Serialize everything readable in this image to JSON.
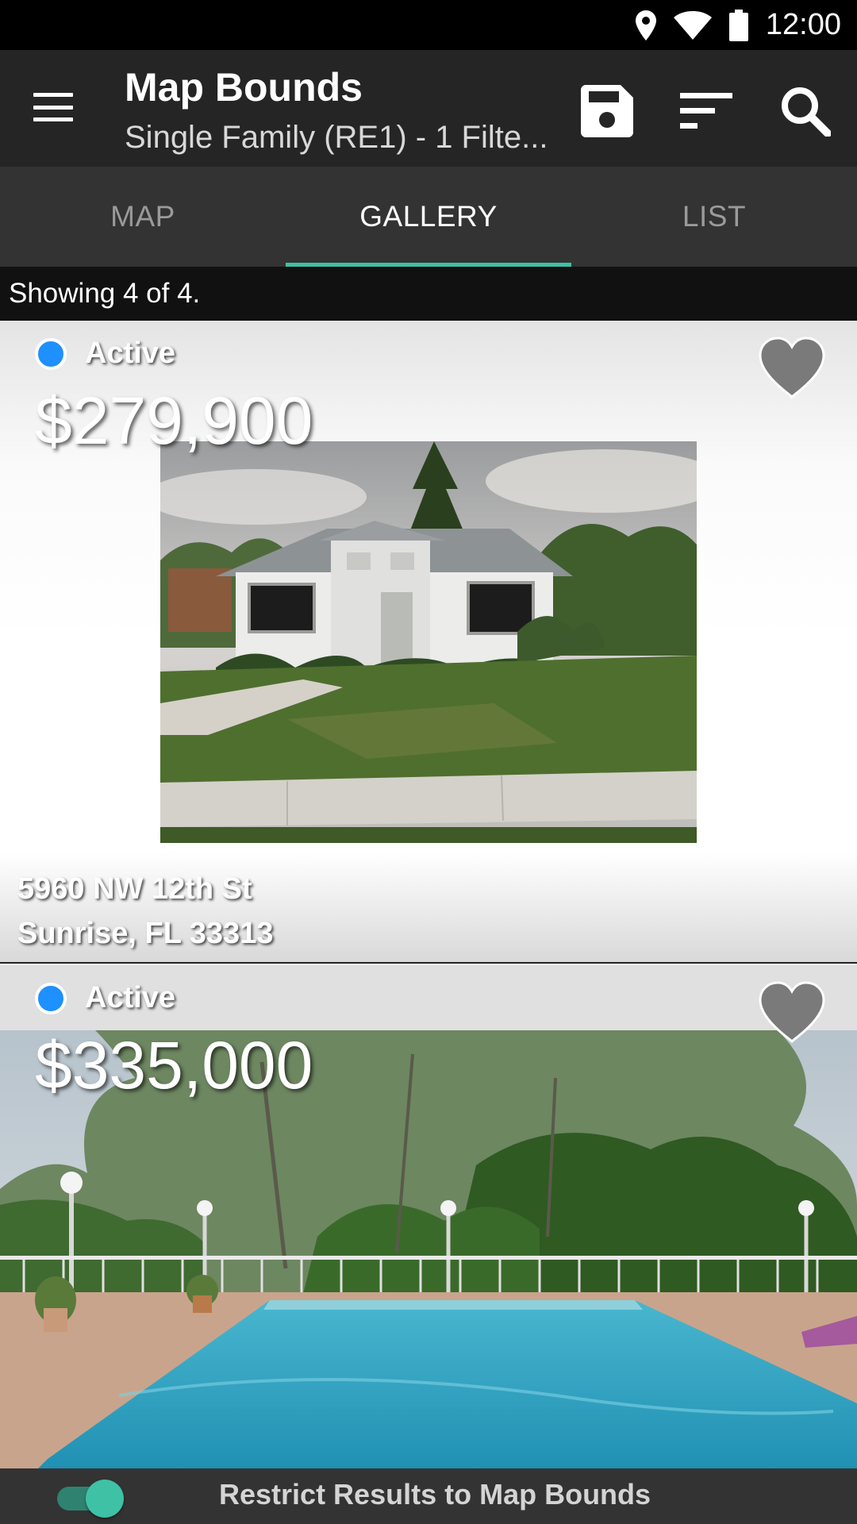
{
  "status_bar": {
    "time": "12:00",
    "icons": [
      "location-icon",
      "wifi-icon",
      "battery-icon"
    ]
  },
  "toolbar": {
    "title": "Map Bounds",
    "subtitle": "Single Family (RE1) - 1 Filte...",
    "actions": [
      "save-icon",
      "sort-icon",
      "search-icon"
    ]
  },
  "tabs": [
    {
      "label": "MAP",
      "active": false
    },
    {
      "label": "GALLERY",
      "active": true
    },
    {
      "label": "LIST",
      "active": false
    }
  ],
  "results": {
    "text": "Showing 4 of 4."
  },
  "listings": [
    {
      "status": "Active",
      "status_color": "#1e90ff",
      "price": "$279,900",
      "address_line1": "5960 NW 12th St",
      "address_line2": "Sunrise, FL 33313",
      "favorited": false
    },
    {
      "status": "Active",
      "status_color": "#1e90ff",
      "price": "$335,000",
      "favorited": false
    }
  ],
  "bottom_bar": {
    "toggle_on": true,
    "label": "Restrict Results to Map Bounds"
  },
  "colors": {
    "accent": "#3fc1a5",
    "toolbar": "#252525",
    "tabs": "#333333",
    "status_active": "#1e90ff"
  }
}
